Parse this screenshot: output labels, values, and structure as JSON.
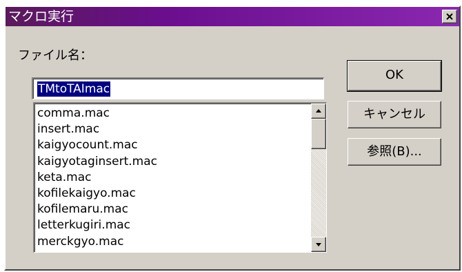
{
  "window": {
    "title": "マクロ実行",
    "close_icon": "close-icon"
  },
  "file_label": "ファイル名：",
  "filename_input": {
    "value": "TMtoTAImac"
  },
  "file_list": {
    "items": [
      "comma.mac",
      "insert.mac",
      "kaigyocount.mac",
      "kaigyotaginsert.mac",
      "keta.mac",
      "kofilekaigyo.mac",
      "kofilemaru.mac",
      "letterkugiri.mac",
      "merckgyo.mac"
    ]
  },
  "buttons": {
    "ok": "OK",
    "cancel": "キャンセル",
    "browse": "参照(B)..."
  },
  "colors": {
    "titlebar_start": "#5a1a5a",
    "titlebar_end": "#8a28b0",
    "selection": "#000080",
    "face": "#d4d0c8"
  }
}
